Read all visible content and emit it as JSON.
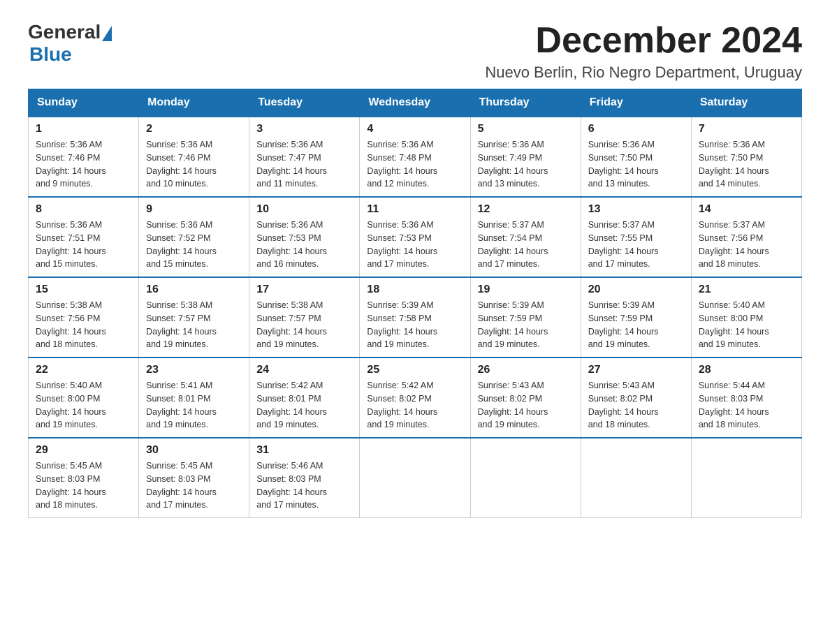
{
  "logo": {
    "general": "General",
    "blue": "Blue"
  },
  "title": "December 2024",
  "subtitle": "Nuevo Berlin, Rio Negro Department, Uruguay",
  "weekdays": [
    "Sunday",
    "Monday",
    "Tuesday",
    "Wednesday",
    "Thursday",
    "Friday",
    "Saturday"
  ],
  "weeks": [
    [
      {
        "day": "1",
        "sunrise": "5:36 AM",
        "sunset": "7:46 PM",
        "daylight": "14 hours and 9 minutes."
      },
      {
        "day": "2",
        "sunrise": "5:36 AM",
        "sunset": "7:46 PM",
        "daylight": "14 hours and 10 minutes."
      },
      {
        "day": "3",
        "sunrise": "5:36 AM",
        "sunset": "7:47 PM",
        "daylight": "14 hours and 11 minutes."
      },
      {
        "day": "4",
        "sunrise": "5:36 AM",
        "sunset": "7:48 PM",
        "daylight": "14 hours and 12 minutes."
      },
      {
        "day": "5",
        "sunrise": "5:36 AM",
        "sunset": "7:49 PM",
        "daylight": "14 hours and 13 minutes."
      },
      {
        "day": "6",
        "sunrise": "5:36 AM",
        "sunset": "7:50 PM",
        "daylight": "14 hours and 13 minutes."
      },
      {
        "day": "7",
        "sunrise": "5:36 AM",
        "sunset": "7:50 PM",
        "daylight": "14 hours and 14 minutes."
      }
    ],
    [
      {
        "day": "8",
        "sunrise": "5:36 AM",
        "sunset": "7:51 PM",
        "daylight": "14 hours and 15 minutes."
      },
      {
        "day": "9",
        "sunrise": "5:36 AM",
        "sunset": "7:52 PM",
        "daylight": "14 hours and 15 minutes."
      },
      {
        "day": "10",
        "sunrise": "5:36 AM",
        "sunset": "7:53 PM",
        "daylight": "14 hours and 16 minutes."
      },
      {
        "day": "11",
        "sunrise": "5:36 AM",
        "sunset": "7:53 PM",
        "daylight": "14 hours and 17 minutes."
      },
      {
        "day": "12",
        "sunrise": "5:37 AM",
        "sunset": "7:54 PM",
        "daylight": "14 hours and 17 minutes."
      },
      {
        "day": "13",
        "sunrise": "5:37 AM",
        "sunset": "7:55 PM",
        "daylight": "14 hours and 17 minutes."
      },
      {
        "day": "14",
        "sunrise": "5:37 AM",
        "sunset": "7:56 PM",
        "daylight": "14 hours and 18 minutes."
      }
    ],
    [
      {
        "day": "15",
        "sunrise": "5:38 AM",
        "sunset": "7:56 PM",
        "daylight": "14 hours and 18 minutes."
      },
      {
        "day": "16",
        "sunrise": "5:38 AM",
        "sunset": "7:57 PM",
        "daylight": "14 hours and 19 minutes."
      },
      {
        "day": "17",
        "sunrise": "5:38 AM",
        "sunset": "7:57 PM",
        "daylight": "14 hours and 19 minutes."
      },
      {
        "day": "18",
        "sunrise": "5:39 AM",
        "sunset": "7:58 PM",
        "daylight": "14 hours and 19 minutes."
      },
      {
        "day": "19",
        "sunrise": "5:39 AM",
        "sunset": "7:59 PM",
        "daylight": "14 hours and 19 minutes."
      },
      {
        "day": "20",
        "sunrise": "5:39 AM",
        "sunset": "7:59 PM",
        "daylight": "14 hours and 19 minutes."
      },
      {
        "day": "21",
        "sunrise": "5:40 AM",
        "sunset": "8:00 PM",
        "daylight": "14 hours and 19 minutes."
      }
    ],
    [
      {
        "day": "22",
        "sunrise": "5:40 AM",
        "sunset": "8:00 PM",
        "daylight": "14 hours and 19 minutes."
      },
      {
        "day": "23",
        "sunrise": "5:41 AM",
        "sunset": "8:01 PM",
        "daylight": "14 hours and 19 minutes."
      },
      {
        "day": "24",
        "sunrise": "5:42 AM",
        "sunset": "8:01 PM",
        "daylight": "14 hours and 19 minutes."
      },
      {
        "day": "25",
        "sunrise": "5:42 AM",
        "sunset": "8:02 PM",
        "daylight": "14 hours and 19 minutes."
      },
      {
        "day": "26",
        "sunrise": "5:43 AM",
        "sunset": "8:02 PM",
        "daylight": "14 hours and 19 minutes."
      },
      {
        "day": "27",
        "sunrise": "5:43 AM",
        "sunset": "8:02 PM",
        "daylight": "14 hours and 18 minutes."
      },
      {
        "day": "28",
        "sunrise": "5:44 AM",
        "sunset": "8:03 PM",
        "daylight": "14 hours and 18 minutes."
      }
    ],
    [
      {
        "day": "29",
        "sunrise": "5:45 AM",
        "sunset": "8:03 PM",
        "daylight": "14 hours and 18 minutes."
      },
      {
        "day": "30",
        "sunrise": "5:45 AM",
        "sunset": "8:03 PM",
        "daylight": "14 hours and 17 minutes."
      },
      {
        "day": "31",
        "sunrise": "5:46 AM",
        "sunset": "8:03 PM",
        "daylight": "14 hours and 17 minutes."
      },
      null,
      null,
      null,
      null
    ]
  ],
  "labels": {
    "sunrise": "Sunrise:",
    "sunset": "Sunset:",
    "daylight": "Daylight:"
  }
}
